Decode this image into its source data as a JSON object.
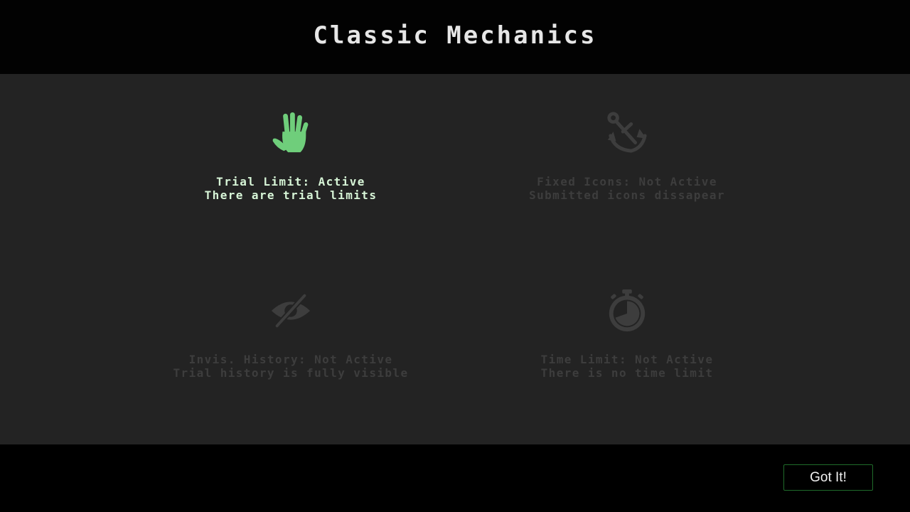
{
  "header": {
    "title": "Classic Mechanics"
  },
  "colors": {
    "active_icon": "#6fce7b",
    "active_text": "#d7f5d7",
    "inactive": "#3d3d3d",
    "panel_bg": "#232323",
    "button_border": "#1f6b2a"
  },
  "mechanics": [
    {
      "icon": "hand-icon",
      "state": "active",
      "label": "Trial Limit: Active",
      "description": "There are trial limits"
    },
    {
      "icon": "anchor-icon",
      "state": "inactive",
      "label": "Fixed Icons: Not Active",
      "description": "Submitted icons dissapear"
    },
    {
      "icon": "eye-slash-icon",
      "state": "inactive",
      "label": "Invis. History: Not Active",
      "description": "Trial history is fully visible"
    },
    {
      "icon": "stopwatch-icon",
      "state": "inactive",
      "label": "Time Limit: Not Active",
      "description": "There is no time limit"
    }
  ],
  "footer": {
    "got_it_label": "Got It!"
  }
}
